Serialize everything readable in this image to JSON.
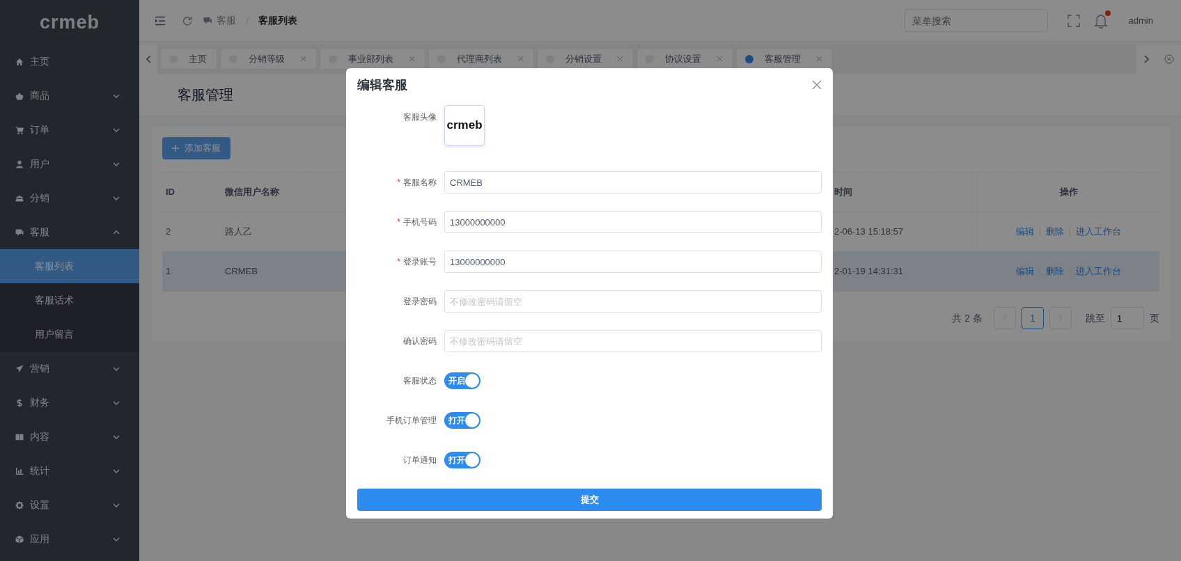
{
  "sidebar": {
    "logo": "crmeb",
    "items": [
      {
        "label": "主页"
      },
      {
        "label": "商品",
        "expanded": false
      },
      {
        "label": "订单",
        "expanded": false
      },
      {
        "label": "用户",
        "expanded": false
      },
      {
        "label": "分销",
        "expanded": false
      },
      {
        "label": "客服",
        "expanded": true,
        "children": [
          {
            "label": "客服列表",
            "selected": true
          },
          {
            "label": "客服话术",
            "selected": false
          },
          {
            "label": "用户留言",
            "selected": false
          }
        ]
      },
      {
        "label": "营销",
        "expanded": false
      },
      {
        "label": "财务",
        "expanded": false
      },
      {
        "label": "内容",
        "expanded": false
      },
      {
        "label": "统计",
        "expanded": false
      },
      {
        "label": "设置",
        "expanded": false
      },
      {
        "label": "应用",
        "expanded": false
      }
    ]
  },
  "header": {
    "breadcrumb": [
      "客服",
      "客服列表"
    ],
    "search": {
      "placeholder": "菜单搜索"
    },
    "has_notification": true,
    "user": "admin"
  },
  "tabs": [
    {
      "label": "主页",
      "selected": false,
      "closable": false
    },
    {
      "label": "分销等级",
      "selected": false,
      "closable": true
    },
    {
      "label": "事业部列表",
      "selected": false,
      "closable": true
    },
    {
      "label": "代理商列表",
      "selected": false,
      "closable": true
    },
    {
      "label": "分销设置",
      "selected": false,
      "closable": true
    },
    {
      "label": "协议设置",
      "selected": false,
      "closable": true
    },
    {
      "label": "客服管理",
      "selected": true,
      "closable": true
    }
  ],
  "page": {
    "title": "客服管理",
    "add_button": "添加客服",
    "table": {
      "columns": [
        "ID",
        "微信用户名称",
        "时间",
        "操作"
      ],
      "rows": [
        {
          "id": "2",
          "name": "路人乙",
          "time": "2-06-13 15:18:57",
          "actions": [
            "编辑",
            "删除",
            "进入工作台"
          ],
          "selected": false
        },
        {
          "id": "1",
          "name": "CRMEB",
          "time": "2-01-19 14:31:31",
          "actions": [
            "编辑",
            "删除",
            "进入工作台"
          ],
          "selected": true
        }
      ]
    },
    "pagination": {
      "total": "共 2 条",
      "pages": [
        {
          "label": "1",
          "selected": true
        }
      ],
      "jump_label": "跳至",
      "jump_value": "1",
      "page_unit": "页"
    }
  },
  "dialog": {
    "title": "编辑客服",
    "required_mark": "*",
    "avatar_label": "客服头像",
    "avatar_text": "crmeb",
    "fields": [
      {
        "label": "客服名称",
        "required": true,
        "value": "CRMEB"
      },
      {
        "label": "手机号码",
        "required": true,
        "value": "13000000000"
      },
      {
        "label": "登录账号",
        "required": true,
        "value": "13000000000"
      },
      {
        "label": "登录密码",
        "required": false,
        "placeholder": "不修改密码请留空"
      },
      {
        "label": "确认密码",
        "required": false,
        "placeholder": "不修改密码请留空"
      }
    ],
    "switches": [
      {
        "label": "客服状态",
        "on": true,
        "text": "开启"
      },
      {
        "label": "手机订单管理",
        "on": true,
        "text": "打开"
      },
      {
        "label": "订单通知",
        "on": true,
        "text": "打开"
      }
    ],
    "submit": "提交"
  }
}
